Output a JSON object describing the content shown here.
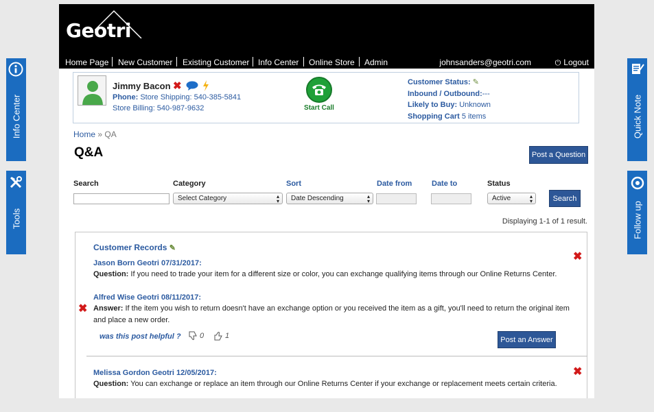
{
  "header": {
    "logo": "Geotri",
    "nav": [
      "Home Page",
      "New Customer",
      "Existing Customer",
      "Info Center",
      "Online Store",
      "Admin"
    ],
    "email": "johnsanders@geotri.com",
    "logout": "Logout"
  },
  "customer": {
    "name": "Jimmy Bacon",
    "phone_label": "Phone:",
    "phone": "Store Shipping: 540-385-5841",
    "billing": "Store Billing: 540-987-9632",
    "start_call": "Start Call",
    "status_label": "Customer Status:",
    "inbound_label": "Inbound / Outbound:",
    "inbound_value": "---",
    "likely_label": "Likely to Buy:",
    "likely_value": "Unknown",
    "cart_label": "Shopping Cart",
    "cart_count": "5",
    "cart_items": "items"
  },
  "breadcrumb": {
    "home": "Home",
    "sep": "»",
    "current": "QA"
  },
  "page_title": "Q&A",
  "post_question": "Post a Question",
  "filters": {
    "search_label": "Search",
    "search_value": "",
    "category_label": "Category",
    "category_value": "Select Category",
    "sort_label": "Sort",
    "sort_value": "Date Descending",
    "date_from_label": "Date from",
    "date_to_label": "Date to",
    "status_label": "Status",
    "status_value": "Active",
    "search_button": "Search"
  },
  "displaying": "Displaying 1-1 of 1 result.",
  "records": {
    "heading": "Customer Records",
    "q1_meta": "Jason Born Geotri 07/31/2017:",
    "q1_label": "Question:",
    "q1_text": "If you need to trade your item for a different size or color, you can exchange qualifying items through our Online Returns Center.",
    "a1_meta": "Alfred Wise Geotri 08/11/2017:",
    "a1_label": "Answer:",
    "a1_text": "If the item you wish to return doesn't have an exchange option or you received the item as a gift, you'll need to return the original item and place a new order.",
    "helpful": "was this post helpful ?",
    "thumbs_down": "0",
    "thumbs_up": "1",
    "post_answer": "Post an Answer",
    "q2_meta": "Melissa Gordon Geotri 12/05/2017:",
    "q2_label": "Question:",
    "q2_text": "You can exchange or replace an item through our Online Returns Center if your exchange or replacement meets certain criteria."
  },
  "side_tabs": {
    "info_center": "Info Center",
    "tools": "Tools",
    "quick_note": "Quick Note",
    "follow_up": "Follow up"
  },
  "colors": {
    "accent": "#2d5797",
    "link": "#2b5aa0",
    "side_tab": "#1b6cc0",
    "delete": "#d21a1a",
    "call": "#1fa038"
  }
}
